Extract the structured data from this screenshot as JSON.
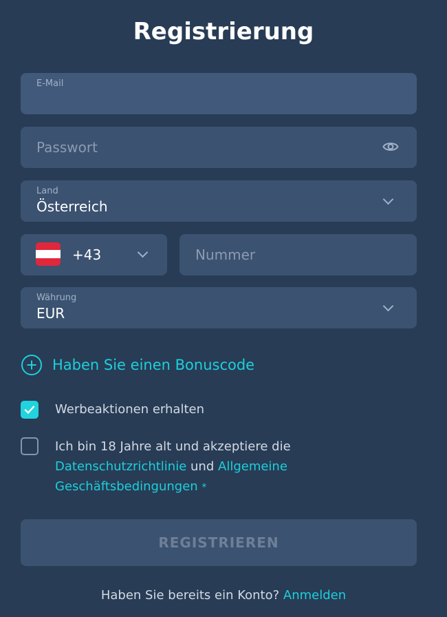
{
  "title": "Registrierung",
  "email": {
    "label": "E-Mail",
    "value": ""
  },
  "password": {
    "placeholder": "Passwort"
  },
  "country": {
    "label": "Land",
    "value": "Österreich"
  },
  "phone": {
    "code": "+43",
    "number_placeholder": "Nummer"
  },
  "currency": {
    "label": "Währung",
    "value": "EUR"
  },
  "bonus": {
    "label": "Haben Sie einen Bonuscode"
  },
  "promos": {
    "label": "Werbeaktionen erhalten",
    "checked": true
  },
  "terms": {
    "text_before": "Ich bin 18 Jahre alt und akzeptiere die",
    "privacy_link": "Datenschutzrichtlinie",
    "and": "und",
    "terms_link": "Allgemeine Geschäftsbedingungen",
    "required_mark": "*",
    "checked": false
  },
  "submit_label": "REGISTRIEREN",
  "footer": {
    "text": "Haben Sie bereits ein Konto?",
    "link": "Anmelden"
  },
  "colors": {
    "background": "#283c55",
    "field": "#3b5271",
    "accent": "#1ccfdc",
    "checkbox_on": "#20d3df"
  },
  "icons": {
    "password": "eye-icon",
    "select": "chevron-down-icon",
    "bonus": "plus-circle-icon",
    "checkbox": "checkmark-icon"
  }
}
